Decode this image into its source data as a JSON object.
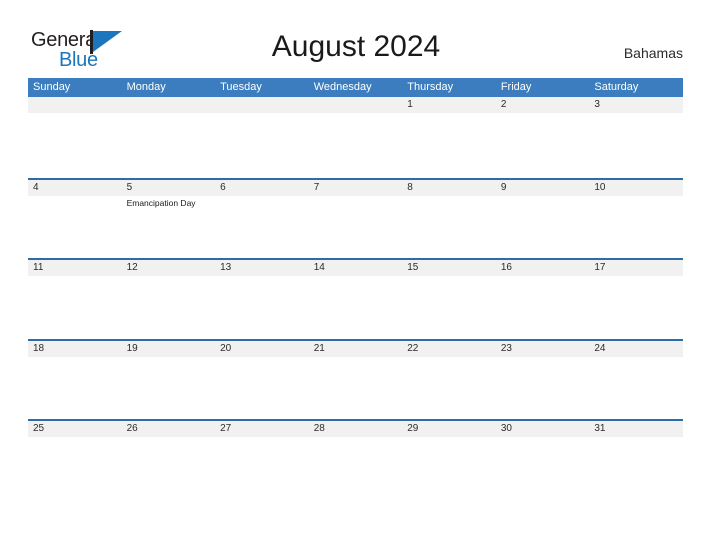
{
  "brand": {
    "name_part1": "General",
    "name_part2": "Blue",
    "mark": "triangle-flag-icon",
    "colors": {
      "dark": "#231f20",
      "blue": "#1b76bd"
    }
  },
  "header": {
    "title": "August 2024",
    "region": "Bahamas"
  },
  "theme": {
    "header_blue": "#3b7dbf",
    "divider_blue": "#2e6da4",
    "band_gray": "#f1f1f1",
    "background": "#ffffff",
    "text": "#2b2b2b"
  },
  "calendar": {
    "weekdays": [
      "Sunday",
      "Monday",
      "Tuesday",
      "Wednesday",
      "Thursday",
      "Friday",
      "Saturday"
    ],
    "weeks": [
      {
        "days": [
          {
            "date": "",
            "events": []
          },
          {
            "date": "",
            "events": []
          },
          {
            "date": "",
            "events": []
          },
          {
            "date": "",
            "events": []
          },
          {
            "date": "1",
            "events": []
          },
          {
            "date": "2",
            "events": []
          },
          {
            "date": "3",
            "events": []
          }
        ]
      },
      {
        "days": [
          {
            "date": "4",
            "events": []
          },
          {
            "date": "5",
            "events": [
              "Emancipation Day"
            ]
          },
          {
            "date": "6",
            "events": []
          },
          {
            "date": "7",
            "events": []
          },
          {
            "date": "8",
            "events": []
          },
          {
            "date": "9",
            "events": []
          },
          {
            "date": "10",
            "events": []
          }
        ]
      },
      {
        "days": [
          {
            "date": "11",
            "events": []
          },
          {
            "date": "12",
            "events": []
          },
          {
            "date": "13",
            "events": []
          },
          {
            "date": "14",
            "events": []
          },
          {
            "date": "15",
            "events": []
          },
          {
            "date": "16",
            "events": []
          },
          {
            "date": "17",
            "events": []
          }
        ]
      },
      {
        "days": [
          {
            "date": "18",
            "events": []
          },
          {
            "date": "19",
            "events": []
          },
          {
            "date": "20",
            "events": []
          },
          {
            "date": "21",
            "events": []
          },
          {
            "date": "22",
            "events": []
          },
          {
            "date": "23",
            "events": []
          },
          {
            "date": "24",
            "events": []
          }
        ]
      },
      {
        "days": [
          {
            "date": "25",
            "events": []
          },
          {
            "date": "26",
            "events": []
          },
          {
            "date": "27",
            "events": []
          },
          {
            "date": "28",
            "events": []
          },
          {
            "date": "29",
            "events": []
          },
          {
            "date": "30",
            "events": []
          },
          {
            "date": "31",
            "events": []
          }
        ]
      }
    ]
  }
}
